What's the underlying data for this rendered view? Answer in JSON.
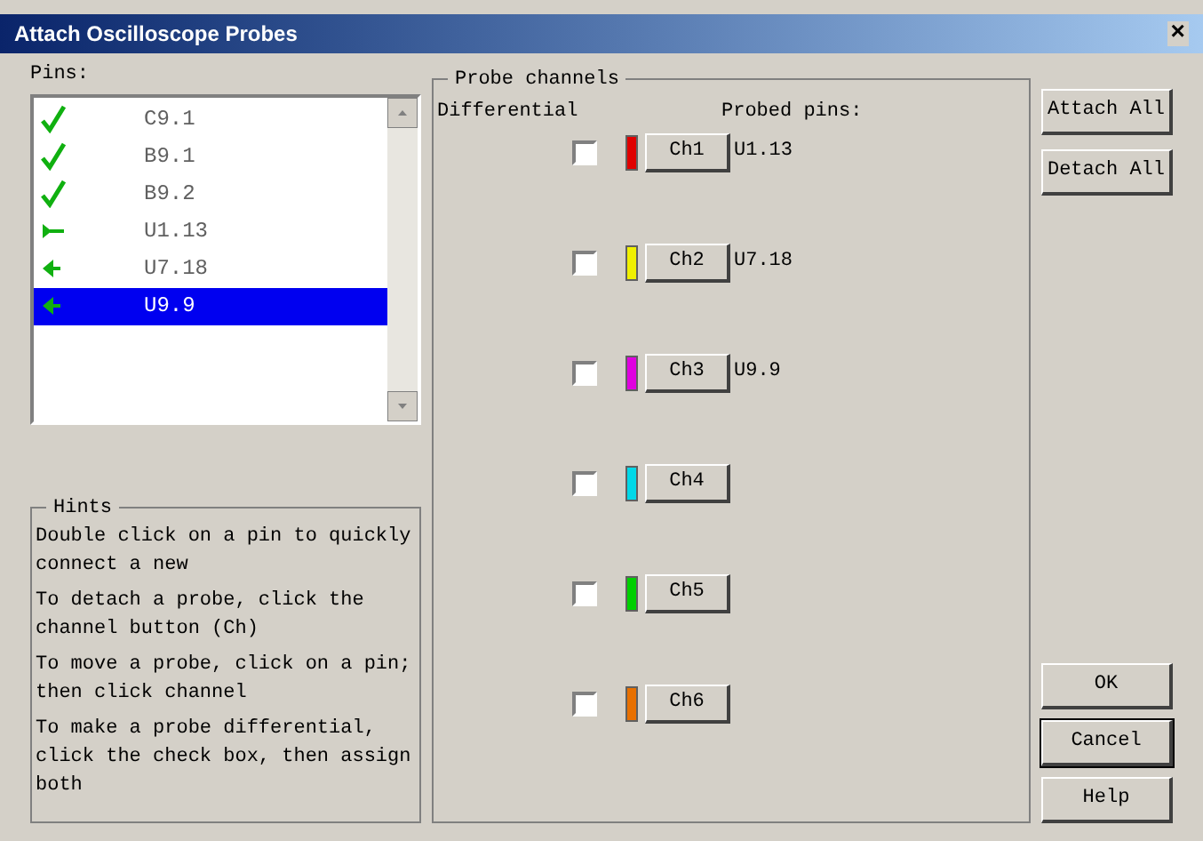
{
  "window": {
    "title": "Attach Oscilloscope Probes",
    "close": "×"
  },
  "pins": {
    "label": "Pins:",
    "items": [
      {
        "name": "C9.1",
        "kind": "check",
        "selected": false
      },
      {
        "name": "B9.1",
        "kind": "check",
        "selected": false
      },
      {
        "name": "B9.2",
        "kind": "check",
        "selected": false
      },
      {
        "name": "U1.13",
        "kind": "probe",
        "selected": false
      },
      {
        "name": "U7.18",
        "kind": "arrow",
        "selected": false
      },
      {
        "name": "U9.9",
        "kind": "arrow",
        "selected": true
      }
    ]
  },
  "hints": {
    "title": "Hints",
    "paragraphs": [
      "Double click on a pin to quickly connect a new",
      "To detach a probe, click the channel button (Ch)",
      "To move a probe, click on a pin; then click channel",
      "To make a probe differential, click the check box, then assign both"
    ]
  },
  "probe_channels": {
    "title": "Probe channels",
    "differential_label": "Differential",
    "probed_pins_label": "Probed pins:",
    "channels": [
      {
        "button": "Ch1",
        "color": "#e00000",
        "differential": false,
        "pin": "U1.13"
      },
      {
        "button": "Ch2",
        "color": "#f0f000",
        "differential": false,
        "pin": "U7.18"
      },
      {
        "button": "Ch3",
        "color": "#e000e0",
        "differential": false,
        "pin": "U9.9"
      },
      {
        "button": "Ch4",
        "color": "#00d8e8",
        "differential": false
      },
      {
        "button": "Ch5",
        "color": "#00d000",
        "differential": false
      },
      {
        "button": "Ch6",
        "color": "#e87000",
        "differential": false
      }
    ]
  },
  "side_buttons": [
    "Attach All",
    "Detach All"
  ],
  "dialog_buttons": [
    {
      "label": "OK",
      "default": false
    },
    {
      "label": "Cancel",
      "default": true
    },
    {
      "label": "Help",
      "default": false
    }
  ]
}
